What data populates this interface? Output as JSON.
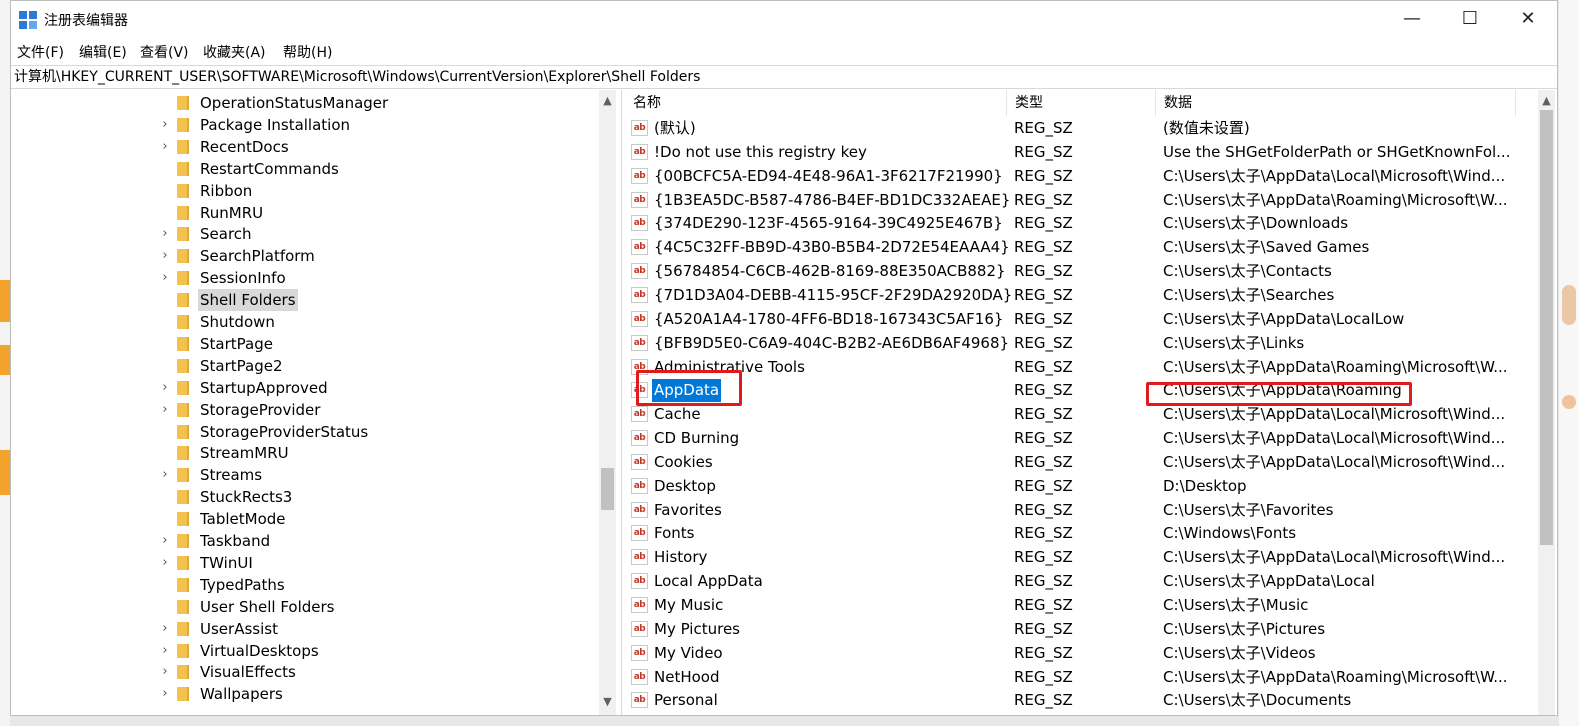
{
  "window": {
    "title": "注册表编辑器",
    "minimize_glyph": "—",
    "maximize_glyph": "☐",
    "close_glyph": "✕"
  },
  "menu": [
    "文件(F)",
    "编辑(E)",
    "查看(V)",
    "收藏夹(A)",
    "帮助(H)"
  ],
  "address": "计算机\\HKEY_CURRENT_USER\\SOFTWARE\\Microsoft\\Windows\\CurrentVersion\\Explorer\\Shell Folders",
  "tree": {
    "items": [
      {
        "label": "OperationStatusManager",
        "expandable": false
      },
      {
        "label": "Package Installation",
        "expandable": true
      },
      {
        "label": "RecentDocs",
        "expandable": true
      },
      {
        "label": "RestartCommands",
        "expandable": false
      },
      {
        "label": "Ribbon",
        "expandable": false
      },
      {
        "label": "RunMRU",
        "expandable": false
      },
      {
        "label": "Search",
        "expandable": true
      },
      {
        "label": "SearchPlatform",
        "expandable": true
      },
      {
        "label": "SessionInfo",
        "expandable": true
      },
      {
        "label": "Shell Folders",
        "expandable": false,
        "selected": true
      },
      {
        "label": "Shutdown",
        "expandable": false
      },
      {
        "label": "StartPage",
        "expandable": false
      },
      {
        "label": "StartPage2",
        "expandable": false
      },
      {
        "label": "StartupApproved",
        "expandable": true
      },
      {
        "label": "StorageProvider",
        "expandable": true
      },
      {
        "label": "StorageProviderStatus",
        "expandable": false
      },
      {
        "label": "StreamMRU",
        "expandable": false
      },
      {
        "label": "Streams",
        "expandable": true
      },
      {
        "label": "StuckRects3",
        "expandable": false
      },
      {
        "label": "TabletMode",
        "expandable": false
      },
      {
        "label": "Taskband",
        "expandable": true
      },
      {
        "label": "TWinUI",
        "expandable": true
      },
      {
        "label": "TypedPaths",
        "expandable": false
      },
      {
        "label": "User Shell Folders",
        "expandable": false
      },
      {
        "label": "UserAssist",
        "expandable": true
      },
      {
        "label": "VirtualDesktops",
        "expandable": true
      },
      {
        "label": "VisualEffects",
        "expandable": true
      },
      {
        "label": "Wallpapers",
        "expandable": true
      }
    ]
  },
  "list": {
    "columns": [
      "名称",
      "类型",
      "数据"
    ],
    "icon_text": "ab",
    "rows": [
      {
        "name": "(默认)",
        "type": "REG_SZ",
        "data": "(数值未设置)"
      },
      {
        "name": "!Do not use this registry key",
        "type": "REG_SZ",
        "data": "Use the SHGetFolderPath or SHGetKnownFol..."
      },
      {
        "name": "{00BCFC5A-ED94-4E48-96A1-3F6217F21990}",
        "type": "REG_SZ",
        "data": "C:\\Users\\太子\\AppData\\Local\\Microsoft\\Wind..."
      },
      {
        "name": "{1B3EA5DC-B587-4786-B4EF-BD1DC332AEAE}",
        "type": "REG_SZ",
        "data": "C:\\Users\\太子\\AppData\\Roaming\\Microsoft\\W..."
      },
      {
        "name": "{374DE290-123F-4565-9164-39C4925E467B}",
        "type": "REG_SZ",
        "data": "C:\\Users\\太子\\Downloads"
      },
      {
        "name": "{4C5C32FF-BB9D-43B0-B5B4-2D72E54EAAA4}",
        "type": "REG_SZ",
        "data": "C:\\Users\\太子\\Saved Games"
      },
      {
        "name": "{56784854-C6CB-462B-8169-88E350ACB882}",
        "type": "REG_SZ",
        "data": "C:\\Users\\太子\\Contacts"
      },
      {
        "name": "{7D1D3A04-DEBB-4115-95CF-2F29DA2920DA}",
        "type": "REG_SZ",
        "data": "C:\\Users\\太子\\Searches"
      },
      {
        "name": "{A520A1A4-1780-4FF6-BD18-167343C5AF16}",
        "type": "REG_SZ",
        "data": "C:\\Users\\太子\\AppData\\LocalLow"
      },
      {
        "name": "{BFB9D5E0-C6A9-404C-B2B2-AE6DB6AF4968}",
        "type": "REG_SZ",
        "data": "C:\\Users\\太子\\Links"
      },
      {
        "name": "Administrative Tools",
        "type": "REG_SZ",
        "data": "C:\\Users\\太子\\AppData\\Roaming\\Microsoft\\W..."
      },
      {
        "name": "AppData",
        "type": "REG_SZ",
        "data": "C:\\Users\\太子\\AppData\\Roaming",
        "selected": true
      },
      {
        "name": "Cache",
        "type": "REG_SZ",
        "data": "C:\\Users\\太子\\AppData\\Local\\Microsoft\\Wind..."
      },
      {
        "name": "CD Burning",
        "type": "REG_SZ",
        "data": "C:\\Users\\太子\\AppData\\Local\\Microsoft\\Wind..."
      },
      {
        "name": "Cookies",
        "type": "REG_SZ",
        "data": "C:\\Users\\太子\\AppData\\Local\\Microsoft\\Wind..."
      },
      {
        "name": "Desktop",
        "type": "REG_SZ",
        "data": "D:\\Desktop"
      },
      {
        "name": "Favorites",
        "type": "REG_SZ",
        "data": "C:\\Users\\太子\\Favorites"
      },
      {
        "name": "Fonts",
        "type": "REG_SZ",
        "data": "C:\\Windows\\Fonts"
      },
      {
        "name": "History",
        "type": "REG_SZ",
        "data": "C:\\Users\\太子\\AppData\\Local\\Microsoft\\Wind..."
      },
      {
        "name": "Local AppData",
        "type": "REG_SZ",
        "data": "C:\\Users\\太子\\AppData\\Local"
      },
      {
        "name": "My Music",
        "type": "REG_SZ",
        "data": "C:\\Users\\太子\\Music"
      },
      {
        "name": "My Pictures",
        "type": "REG_SZ",
        "data": "C:\\Users\\太子\\Pictures"
      },
      {
        "name": "My Video",
        "type": "REG_SZ",
        "data": "C:\\Users\\太子\\Videos"
      },
      {
        "name": "NetHood",
        "type": "REG_SZ",
        "data": "C:\\Users\\太子\\AppData\\Roaming\\Microsoft\\W..."
      },
      {
        "name": "Personal",
        "type": "REG_SZ",
        "data": "C:\\Users\\太子\\Documents"
      }
    ]
  },
  "colors": {
    "selection": "#0078d7",
    "highlight_box": "#e01b1b",
    "folder": "#f2c14e"
  }
}
